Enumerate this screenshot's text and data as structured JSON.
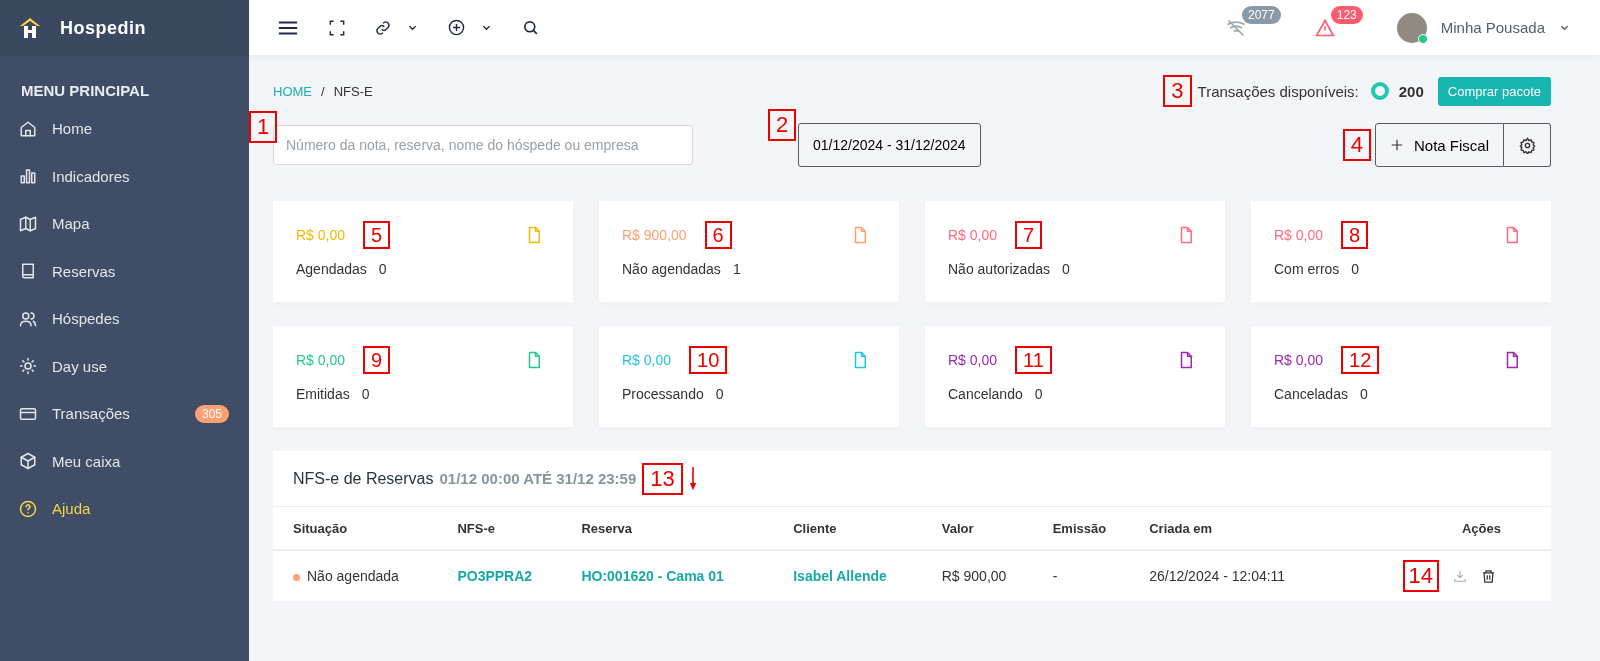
{
  "brand": {
    "name": "Hospedin"
  },
  "sidebar": {
    "heading": "MENU PRINCIPAL",
    "items": [
      {
        "label": "Home",
        "kind": "home",
        "highlighted": false
      },
      {
        "label": "Indicadores",
        "kind": "chart",
        "highlighted": false
      },
      {
        "label": "Mapa",
        "kind": "map",
        "highlighted": false
      },
      {
        "label": "Reservas",
        "kind": "book",
        "highlighted": false
      },
      {
        "label": "Hóspedes",
        "kind": "users",
        "highlighted": false
      },
      {
        "label": "Day use",
        "kind": "sun",
        "highlighted": false
      },
      {
        "label": "Transações",
        "kind": "card",
        "highlighted": false,
        "badge": "305"
      },
      {
        "label": "Meu caixa",
        "kind": "box",
        "highlighted": false
      },
      {
        "label": "Ajuda",
        "kind": "help",
        "highlighted": true
      }
    ]
  },
  "topbar": {
    "notifications": [
      {
        "kind": "wifi-off",
        "count": "2077",
        "color": "#8a9aa8"
      },
      {
        "kind": "alert",
        "count": "123",
        "color": "#ff5b6e"
      }
    ],
    "user": {
      "name": "Minha Pousada"
    }
  },
  "breadcrumb": {
    "items": [
      {
        "label": "HOME",
        "link": true
      },
      {
        "label": "NFS-E",
        "link": false
      }
    ],
    "separator": "/"
  },
  "transactions": {
    "label": "Transações disponíveis:",
    "count": "200",
    "button": "Comprar pacote",
    "marker": "3"
  },
  "search": {
    "placeholder": "Número da nota, reserva, nome do hóspede ou empresa",
    "marker": "1"
  },
  "date_range": {
    "value": "01/12/2024 - 31/12/2024",
    "marker": "2"
  },
  "new_invoice": {
    "label": "Nota Fiscal",
    "marker": "4"
  },
  "cards": [
    {
      "amount": "R$ 0,00",
      "label": "Agendadas",
      "count": "0",
      "color": "#f2b705",
      "marker": "5"
    },
    {
      "amount": "R$ 900,00",
      "label": "Não agendadas",
      "count": "1",
      "color": "#ff9f73",
      "marker": "6"
    },
    {
      "amount": "R$ 0,00",
      "label": "Não autorizadas",
      "count": "0",
      "color": "#ff6b81",
      "marker": "7"
    },
    {
      "amount": "R$ 0,00",
      "label": "Com erros",
      "count": "0",
      "color": "#ff6b81",
      "marker": "8"
    },
    {
      "amount": "R$ 0,00",
      "label": "Emitidas",
      "count": "0",
      "color": "#1ec98b",
      "marker": "9"
    },
    {
      "amount": "R$ 0,00",
      "label": "Processando",
      "count": "0",
      "color": "#22c3e6",
      "marker": "10"
    },
    {
      "amount": "R$ 0,00",
      "label": "Cancelando",
      "count": "0",
      "color": "#9c27b0",
      "marker": "11"
    },
    {
      "amount": "R$ 0,00",
      "label": "Canceladas",
      "count": "0",
      "color": "#9c27b0",
      "marker": "12"
    }
  ],
  "table": {
    "title": "NFS-e de Reservas",
    "period": "01/12 00:00 ATÉ 31/12 23:59",
    "marker": "13",
    "columns": [
      "Situação",
      "NFS-e",
      "Reserva",
      "Cliente",
      "Valor",
      "Emissão",
      "Criada em",
      "Ações"
    ],
    "rows": [
      {
        "status": "Não agendada",
        "color": "#ff9f73",
        "nfse": "PO3PPRA2",
        "reserva": "HO:001620 - Cama 01",
        "cliente": "Isabel Allende",
        "valor": "R$ 900,00",
        "emissao": "-",
        "criada": "26/12/2024 - 12:04:11",
        "marker": "14"
      }
    ]
  }
}
